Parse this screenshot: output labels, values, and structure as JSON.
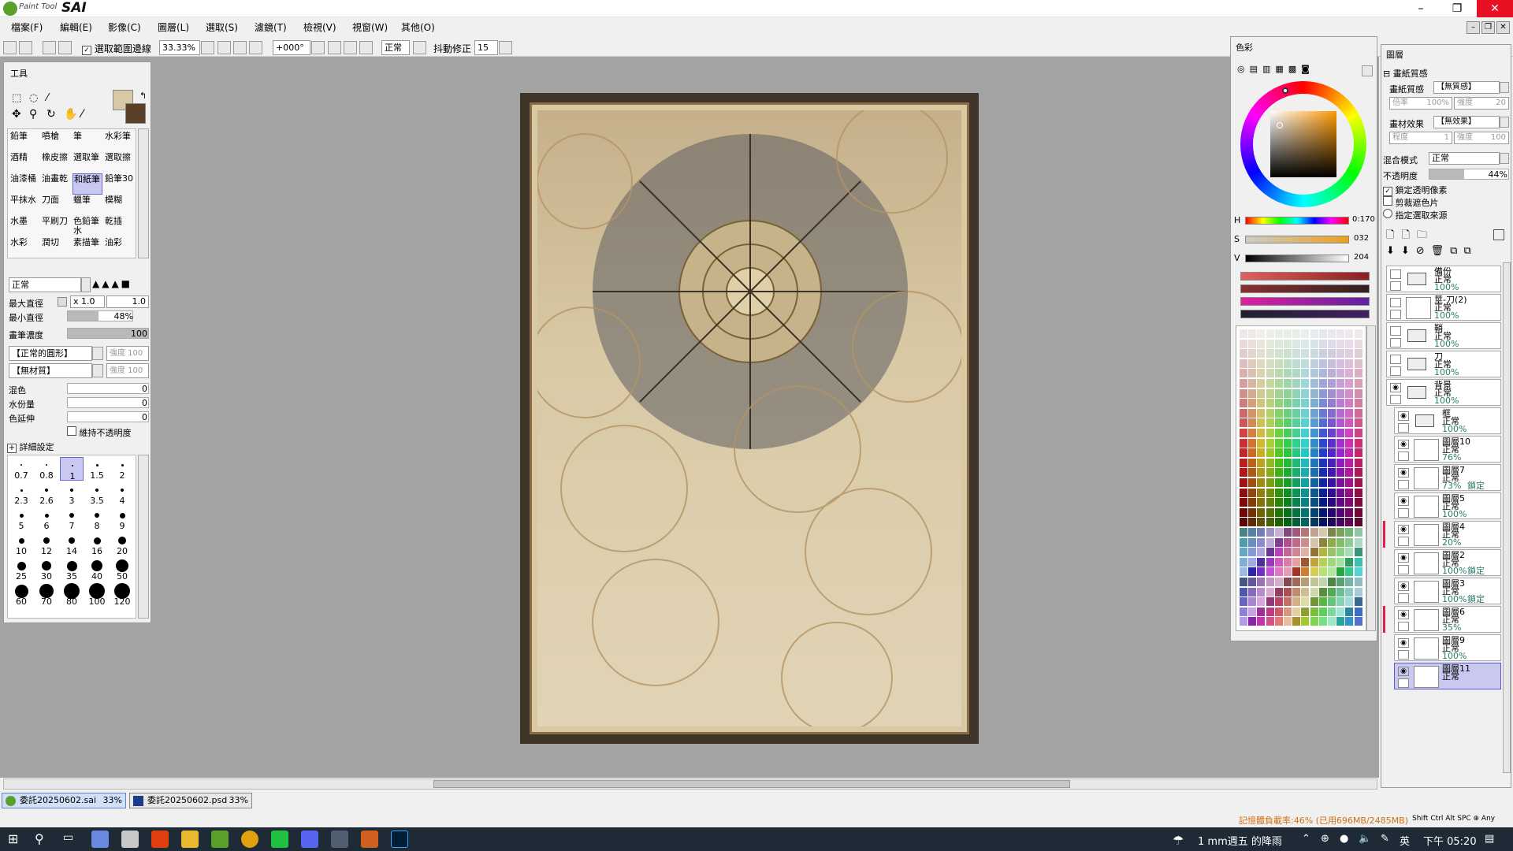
{
  "app": {
    "logo_small": "Paint Tool",
    "logo_big": "SAI",
    "win_min": "–",
    "win_restore": "❐",
    "win_close": "✕"
  },
  "menu": [
    "檔案(F)",
    "編輯(E)",
    "影像(C)",
    "圖層(L)",
    "選取(S)",
    "濾鏡(T)",
    "檢視(V)",
    "視窗(W)",
    "其他(O)"
  ],
  "toolbar": {
    "select_source_label": "選取範圍邊線",
    "zoom": "33.33%",
    "angle": "+000°",
    "blend": "正常",
    "stabilizer_label": "抖動修正",
    "stabilizer_value": "15"
  },
  "tools": {
    "title": "工具",
    "brushes": [
      [
        "鉛筆",
        "噴槍",
        "筆",
        "水彩筆"
      ],
      [
        "酒精",
        "橡皮擦",
        "選取筆",
        "選取擦"
      ],
      [
        "油漆桶",
        "油畫乾",
        "和紙筆",
        "鉛筆30"
      ],
      [
        "平抹水",
        "刀面",
        "蠟筆",
        "模糊"
      ],
      [
        "水墨",
        "平刷刀",
        "色鉛筆水",
        "乾插"
      ],
      [
        "水彩",
        "潤切",
        "素描筆",
        "油彩"
      ]
    ],
    "mode": "正常",
    "max_diam_label": "最大直徑",
    "max_diam_mult": "x 1.0",
    "max_diam_value": "1.0",
    "min_diam_label": "最小直徑",
    "min_diam_value": "48%",
    "min_diam_level": 0.48,
    "density_label": "畫筆濃度",
    "density_value": "100",
    "density_level": 1.0,
    "shape": "【正常的圓形】",
    "shape_strength": "強度 100",
    "texture": "【無材質】",
    "texture_strength": "強度 100",
    "blend_label": "混色",
    "blend_value": "0",
    "water_label": "水份量",
    "water_value": "0",
    "ext_label": "色延伸",
    "ext_value": "0",
    "keep_opacity": "維持不透明度",
    "detail": "詳細設定",
    "sizes": [
      "0.7",
      "0.8",
      "1",
      "1.5",
      "2",
      "2.3",
      "2.6",
      "3",
      "3.5",
      "4",
      "5",
      "6",
      "7",
      "8",
      "9",
      "10",
      "12",
      "14",
      "16",
      "20",
      "25",
      "30",
      "35",
      "40",
      "50",
      "60",
      "70",
      "80",
      "100",
      "120"
    ]
  },
  "color": {
    "title": "色彩",
    "h_label": "H",
    "h_value": "0:170",
    "s_label": "S",
    "s_value": "032",
    "v_label": "V",
    "v_value": "204"
  },
  "layers": {
    "title": "圖層",
    "paper_tex_label": "畫紙質感",
    "paper_tex_value": "【無質感】",
    "scale_label": "倍率",
    "scale_value": "100%",
    "strength_label": "強度",
    "strength_value": "20",
    "brush_fx_label": "畫材效果",
    "brush_fx_value": "【無效果】",
    "degree_label": "程度",
    "degree_value": "1",
    "strength2_value": "100",
    "blend_label": "混合模式",
    "blend_value": "正常",
    "opacity_label": "不透明度",
    "opacity_value": "44%",
    "opacity_level": 0.44,
    "lock_alpha": "鎖定透明像素",
    "clip": "剪裁遮色片",
    "sel_source": "指定選取來源",
    "items": [
      {
        "name": "備份",
        "mode": "正常",
        "opacity": "100%",
        "lock": "",
        "folder": true,
        "eye": false,
        "indent": 0,
        "red": false,
        "sel": false
      },
      {
        "name": "莖-刀(2)",
        "mode": "正常",
        "opacity": "100%",
        "lock": "",
        "folder": false,
        "eye": false,
        "indent": 0,
        "red": false,
        "sel": false
      },
      {
        "name": "鞘",
        "mode": "正常",
        "opacity": "100%",
        "lock": "",
        "folder": true,
        "eye": false,
        "indent": 0,
        "red": false,
        "sel": false
      },
      {
        "name": "刀",
        "mode": "正常",
        "opacity": "100%",
        "lock": "",
        "folder": true,
        "eye": false,
        "indent": 0,
        "red": false,
        "sel": false
      },
      {
        "name": "背景",
        "mode": "正常",
        "opacity": "100%",
        "lock": "",
        "folder": true,
        "eye": true,
        "indent": 0,
        "red": false,
        "sel": false
      },
      {
        "name": "框",
        "mode": "正常",
        "opacity": "100%",
        "lock": "",
        "folder": true,
        "eye": true,
        "indent": 1,
        "red": false,
        "sel": false
      },
      {
        "name": "圖層10",
        "mode": "正常",
        "opacity": "76%",
        "lock": "",
        "folder": false,
        "eye": true,
        "indent": 1,
        "red": false,
        "sel": false
      },
      {
        "name": "圖層7",
        "mode": "正常",
        "opacity": "73%",
        "lock": "鎖定",
        "folder": false,
        "eye": true,
        "indent": 1,
        "red": false,
        "sel": false
      },
      {
        "name": "圖層5",
        "mode": "正常",
        "opacity": "100%",
        "lock": "",
        "folder": false,
        "eye": true,
        "indent": 1,
        "red": false,
        "sel": false
      },
      {
        "name": "圖層4",
        "mode": "正常",
        "opacity": "20%",
        "lock": "",
        "folder": false,
        "eye": true,
        "indent": 1,
        "red": true,
        "sel": false
      },
      {
        "name": "圖層2",
        "mode": "正常",
        "opacity": "100%",
        "lock": "鎖定",
        "folder": false,
        "eye": true,
        "indent": 1,
        "red": false,
        "sel": false
      },
      {
        "name": "圖層3",
        "mode": "正常",
        "opacity": "100%",
        "lock": "鎖定",
        "folder": false,
        "eye": true,
        "indent": 1,
        "red": false,
        "sel": false
      },
      {
        "name": "圖層6",
        "mode": "正常",
        "opacity": "35%",
        "lock": "",
        "folder": false,
        "eye": true,
        "indent": 1,
        "red": true,
        "sel": false
      },
      {
        "name": "圖層9",
        "mode": "正常",
        "opacity": "100%",
        "lock": "",
        "folder": false,
        "eye": true,
        "indent": 1,
        "red": false,
        "sel": false
      },
      {
        "name": "圖層11",
        "mode": "正常",
        "opacity": "",
        "lock": "",
        "folder": false,
        "eye": true,
        "indent": 1,
        "red": false,
        "sel": true
      }
    ]
  },
  "tabs": [
    {
      "name": "委託20250602.sai",
      "zoom": "33%"
    },
    {
      "name": "委託20250602.psd",
      "zoom": "33%"
    }
  ],
  "status": {
    "memory": "記憶體負載率:46% (已用696MB/2485MB)",
    "keys": "Shift Ctrl Alt SPC ⊕ Any"
  },
  "taskbar": {
    "weather": "1 mm週五 的降雨",
    "ime": "英",
    "time": "下午 05:20"
  }
}
